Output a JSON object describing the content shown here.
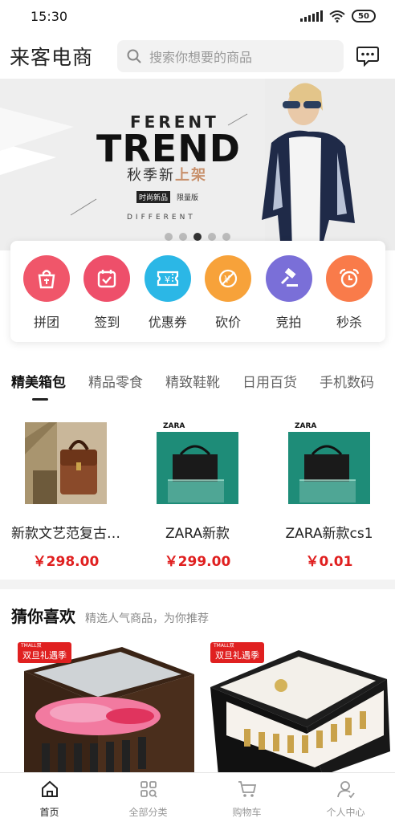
{
  "status_bar": {
    "time": "15:30",
    "battery": "50"
  },
  "header": {
    "logo": "来客电商",
    "search_placeholder": "搜索你想要的商品"
  },
  "banner": {
    "brand": "FERENT",
    "title": "TREND",
    "subtitle_main": "秋季新",
    "subtitle_highlight": "上架",
    "tag_dark": "时尚新品",
    "tag_light": "限量版",
    "footer_text": "DIFFERENT",
    "dot_count": 5,
    "active_dot": 2
  },
  "quick_menu": [
    {
      "label": "拼团",
      "icon": "bag-icon",
      "color": "#f0566a"
    },
    {
      "label": "签到",
      "icon": "calendar-check-icon",
      "color": "#ee4f6a"
    },
    {
      "label": "优惠券",
      "icon": "coupon-icon",
      "color": "#2bb7e6"
    },
    {
      "label": "砍价",
      "icon": "price-cut-icon",
      "color": "#f7a23a"
    },
    {
      "label": "竞拍",
      "icon": "auction-hammer-icon",
      "color": "#7a6fd8"
    },
    {
      "label": "秒杀",
      "icon": "alarm-clock-icon",
      "color": "#f97b4a"
    }
  ],
  "category_tabs": [
    "精美箱包",
    "精品零食",
    "精致鞋靴",
    "日用百货",
    "手机数码"
  ],
  "active_tab": 0,
  "products": [
    {
      "name": "新款文艺范复古…",
      "price": "￥298.00"
    },
    {
      "name": "ZARA新款",
      "price": "￥299.00",
      "brand_mark": "ZARA"
    },
    {
      "name": "ZARA新款cs1",
      "price": "￥0.01",
      "brand_mark": "ZARA"
    }
  ],
  "recommend": {
    "title": "猜你喜欢",
    "subtitle": "精选人气商品，为你推荐",
    "badge_text": "双旦礼遇季",
    "badge_top": "TMALL双"
  },
  "tabbar": [
    {
      "label": "首页",
      "icon": "home-icon"
    },
    {
      "label": "全部分类",
      "icon": "category-grid-icon"
    },
    {
      "label": "购物车",
      "icon": "cart-icon"
    },
    {
      "label": "个人中心",
      "icon": "user-icon"
    }
  ],
  "active_tabbar": 0,
  "colors": {
    "price": "#e02020",
    "badge": "#e02020",
    "banner_bg": "#eeeeee"
  }
}
